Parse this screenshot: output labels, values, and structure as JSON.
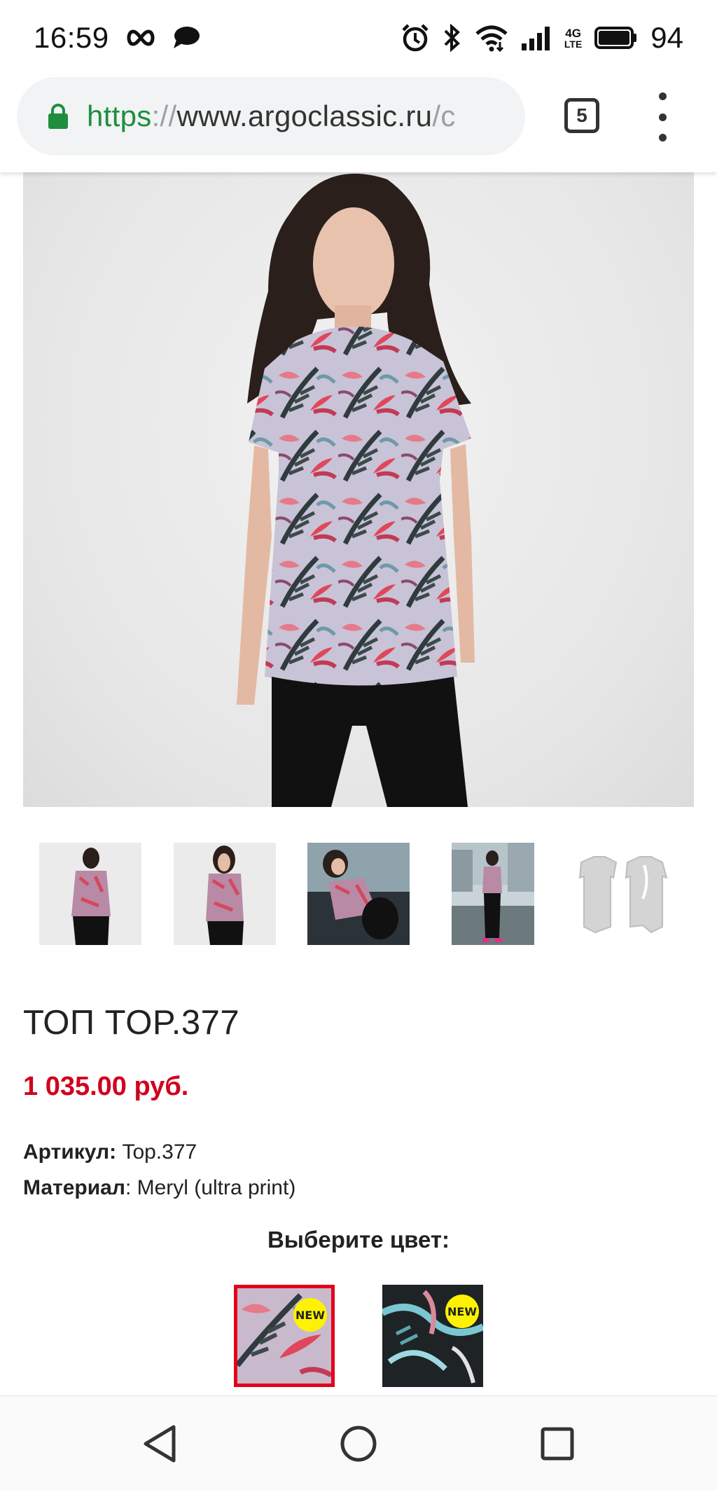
{
  "status_bar": {
    "time": "16:59",
    "battery": "94",
    "network": "4G",
    "network_sub": "LTE",
    "icons": [
      "infinity-icon",
      "chat-bubble-icon",
      "alarm-icon",
      "bluetooth-icon",
      "wifi-icon",
      "signal-icon",
      "battery-icon"
    ]
  },
  "browser": {
    "url_scheme": "https",
    "url_separator": "://",
    "url_host": "www.argoclassic.ru",
    "url_rest": "/c",
    "tab_count": "5"
  },
  "gallery": {
    "thumbnails": [
      {
        "name": "thumb-back-view"
      },
      {
        "name": "thumb-front-view"
      },
      {
        "name": "thumb-lifestyle-car"
      },
      {
        "name": "thumb-lifestyle-outdoor"
      },
      {
        "name": "thumb-sketch"
      }
    ]
  },
  "product": {
    "title": "ТОП TOP.377",
    "price": "1 035.00 руб.",
    "article_label": "Артикул:",
    "article_value": "Top.377",
    "material_label": "Материал",
    "material_value": ": Meryl (ultra print)",
    "choose_color_label": "Выберите цвет:",
    "swatches": [
      {
        "badge": "NEW",
        "selected": true
      },
      {
        "badge": "NEW",
        "selected": false
      }
    ]
  },
  "colors": {
    "price": "#d0021b",
    "selected_border": "#e3001b",
    "badge": "#fff200",
    "secure_lock": "#1e8e3e"
  }
}
